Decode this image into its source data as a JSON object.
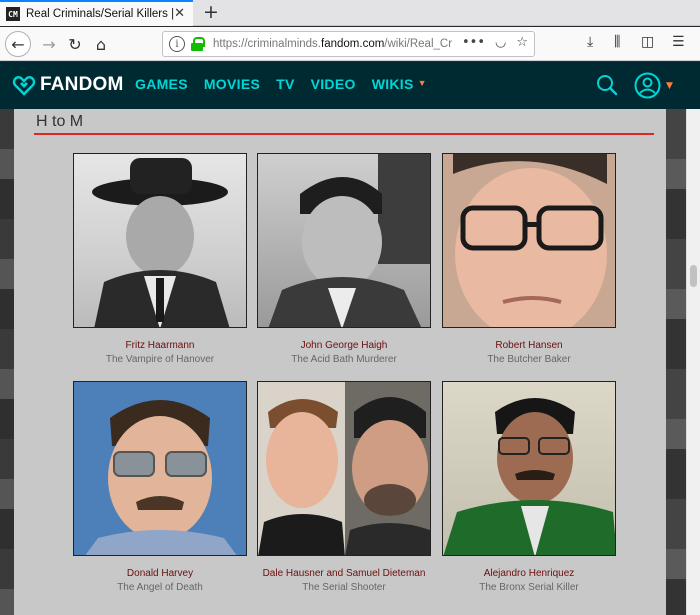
{
  "browser": {
    "tab_title": "Real Criminals/Serial Killers |",
    "favicon_text": "CM",
    "url_prefix": "https://criminalminds.",
    "url_host": "fandom.com",
    "url_suffix": "/wiki/Real_Cr"
  },
  "fandom": {
    "logo_text": "FANDOM",
    "nav": [
      "GAMES",
      "MOVIES",
      "TV",
      "VIDEO",
      "WIKIS"
    ],
    "accent": "#00d6d6",
    "caret_color": "#ff7a3d"
  },
  "section": {
    "title": "H to M",
    "rule_color": "#d82828"
  },
  "cards": [
    {
      "name": "Fritz Haarmann",
      "alias": "The Vampire of Hanover"
    },
    {
      "name": "John George Haigh",
      "alias": "The Acid Bath Murderer"
    },
    {
      "name": "Robert Hansen",
      "alias": "The Butcher Baker"
    },
    {
      "name": "Donald Harvey",
      "alias": "The Angel of Death"
    },
    {
      "name": "Dale Hausner and Samuel Dieteman",
      "alias": "The Serial Shooter"
    },
    {
      "name": "Alejandro Henriquez",
      "alias": "The Bronx Serial Killer"
    }
  ]
}
